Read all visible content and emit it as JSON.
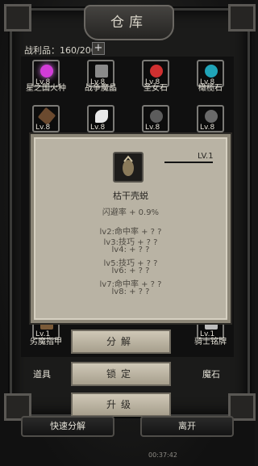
{
  "window": {
    "title": "仓库"
  },
  "capacity": {
    "label": "战利品：160/200",
    "add": "+"
  },
  "items_row1": [
    {
      "level": "Lv.8",
      "name": "星之国火种",
      "color": "#d33cd9"
    },
    {
      "level": "Lv.8",
      "name": "战争魔晶",
      "color": "#8a8a8a"
    },
    {
      "level": "Lv.8",
      "name": "圣女石",
      "color": "#d03030"
    },
    {
      "level": "Lv.8",
      "name": "橄榄石",
      "color": "#20a4b8"
    }
  ],
  "items_row2": [
    {
      "level": "Lv.8"
    },
    {
      "level": "Lv.8"
    },
    {
      "level": "Lv.8"
    },
    {
      "level": "Lv.8"
    }
  ],
  "items_row_bottom": [
    {
      "level": "Lv.1",
      "name": "劣魔指甲"
    },
    {
      "level": "Lv.1",
      "name": "骑士铭牌"
    }
  ],
  "popup": {
    "level_tag": "LV.1",
    "name": "枯干壳蜕",
    "main_stat": "闪避率 + 0.9%",
    "bonuses": [
      "lv2:命中率 + ? ?",
      "lv3:技巧 + ? ?",
      "lv4: + ? ?",
      "lv5:技巧 + ? ?",
      "lv6: + ? ?",
      "lv7:命中率 + ? ?",
      "lv8: + ? ?"
    ]
  },
  "actions": {
    "decompose": "分解",
    "lock": "锁定",
    "upgrade": "升级"
  },
  "side": {
    "props": "道具",
    "magic_stone": "魔石"
  },
  "bottom": {
    "quick_decompose": "快速分解",
    "leave": "离开"
  },
  "hud": {
    "time": "00:37:42"
  }
}
